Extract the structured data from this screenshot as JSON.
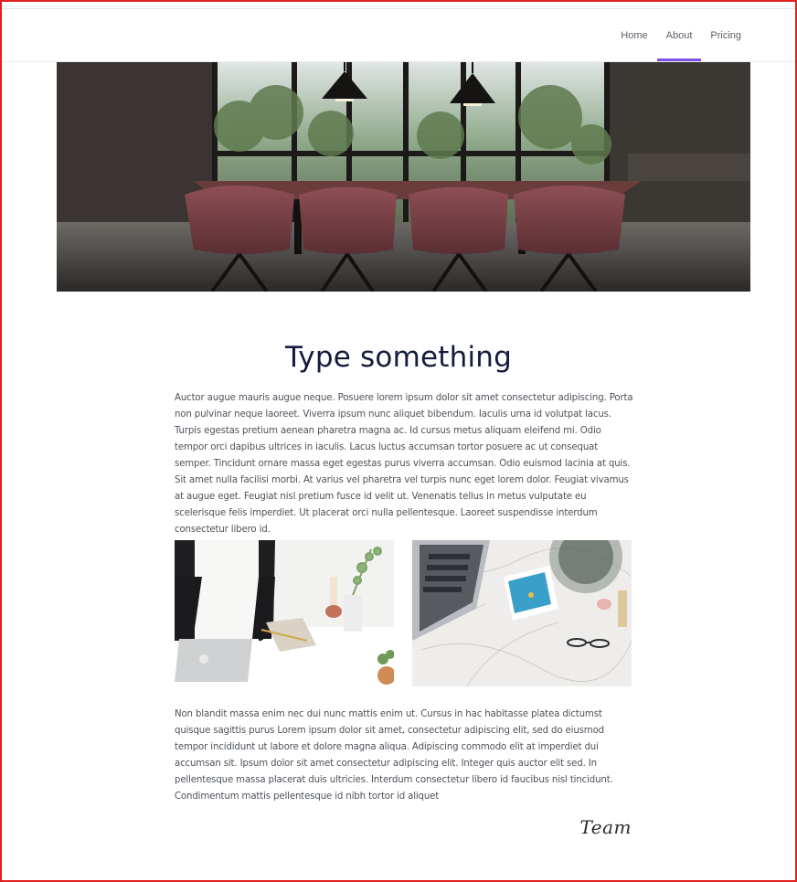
{
  "nav": {
    "items": [
      {
        "label": "Home",
        "active": false
      },
      {
        "label": "About",
        "active": true
      },
      {
        "label": "Pricing",
        "active": false
      }
    ],
    "accent_color": "#7b52e3"
  },
  "hero": {
    "image": "meeting-room-photo",
    "icon": "conference-table-image"
  },
  "main": {
    "title": "Type something",
    "paragraph1": "Auctor augue mauris augue neque. Posuere lorem ipsum dolor sit amet consectetur adipiscing. Porta non pulvinar neque laoreet. Viverra ipsum nunc aliquet bibendum. Iaculis urna id volutpat lacus. Turpis egestas pretium aenean pharetra magna ac. Id cursus metus aliquam eleifend mi. Odio tempor orci dapibus ultrices in iaculis. Lacus luctus accumsan tortor posuere ac ut consequat semper. Tincidunt ornare massa eget egestas purus viverra accumsan. Odio euismod lacinia at quis. Sit amet nulla facilisi morbi. At varius vel pharetra vel turpis nunc eget lorem dolor. Feugiat vivamus at augue eget. Feugiat nisl pretium fusce id velit ut. Venenatis tellus in metus vulputate eu scelerisque felis imperdiet. Ut placerat orci nulla pellentesque. Laoreet suspendisse interdum consectetur libero id.",
    "paragraph2": "Non blandit massa enim nec dui nunc mattis enim ut. Cursus in hac habitasse platea dictumst quisque sagittis purus Lorem ipsum dolor sit amet, consectetur adipiscing elit, sed do eiusmod tempor incididunt ut labore et dolore magna aliqua. Adipiscing commodo elit at imperdiet dui accumsan sit. Ipsum dolor sit amet consectetur adipiscing elit. Integer quis auctor elit sed. In pellentesque massa placerat duis ultricies. Interdum consectetur libero id faucibus nisl tincidunt. Condimentum mattis pellentesque id nibh tortor id aliquet",
    "signature": "Team"
  },
  "images": {
    "left": "person-laptop-desk-photo",
    "right": "laptop-marble-desk-photo"
  },
  "colors": {
    "frame": "#e0201e",
    "title": "#141c3d",
    "body_text": "#4d5259"
  }
}
